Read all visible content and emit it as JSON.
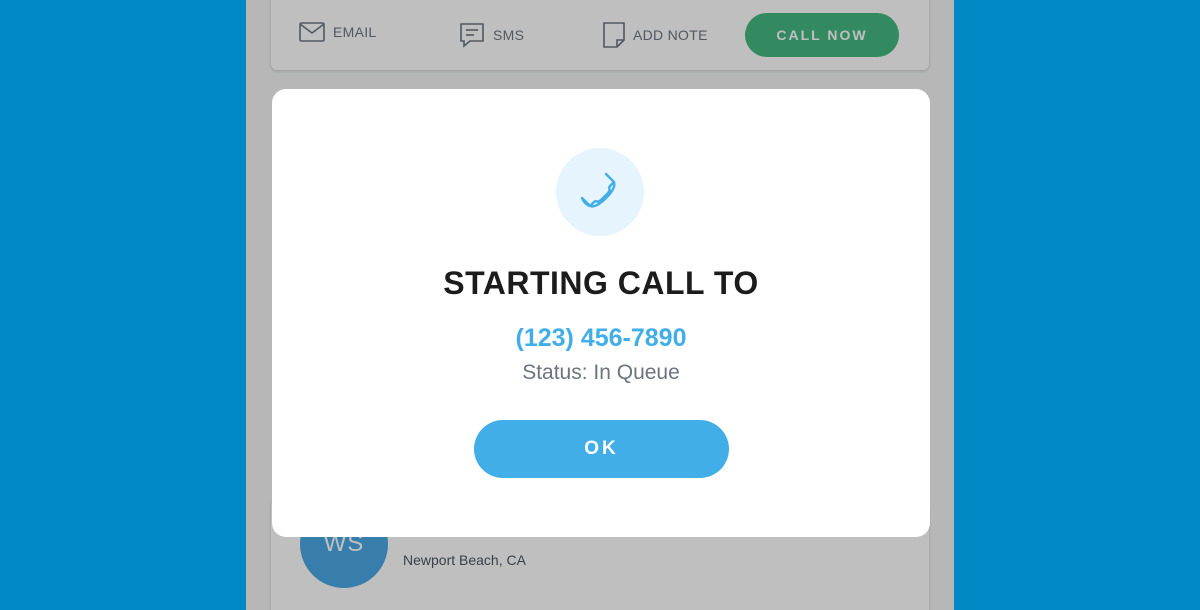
{
  "actions": {
    "email_label": "EMAIL",
    "sms_label": "SMS",
    "add_note_label": "ADD NOTE",
    "call_now_label": "CALL NOW"
  },
  "contact": {
    "initials": "WS",
    "location": "Newport Beach, CA"
  },
  "modal": {
    "title": "STARTING CALL TO",
    "phone": "(123) 456-7890",
    "status": "Status: In Queue",
    "ok_label": "OK",
    "icon": "phone-icon"
  },
  "colors": {
    "background": "#0089c4",
    "accent_blue": "#42aee8",
    "call_green": "#44b781"
  }
}
